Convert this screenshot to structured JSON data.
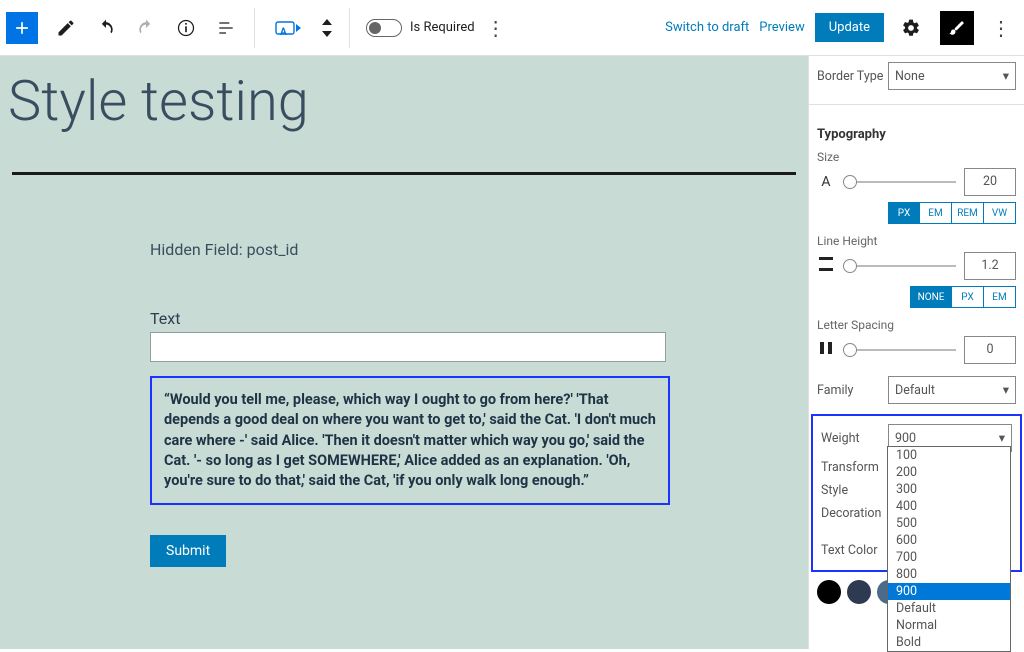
{
  "toolbar": {
    "is_required": "Is Required",
    "switch_draft": "Switch to draft",
    "preview": "Preview",
    "update": "Update"
  },
  "page": {
    "title": "Style testing"
  },
  "form": {
    "hidden_field": "Hidden Field: post_id",
    "text_label": "Text",
    "quote": "“Would you tell me, please, which way I ought to go from here?' 'That depends a good deal on where you want to get to,' said the Cat. 'I don't much care where -' said Alice. 'Then it doesn't matter which way you go,' said the Cat. '- so long as I get SOMEWHERE,' Alice added as an explanation. 'Oh, you're sure to do that,' said the Cat, 'if you only walk long enough.”",
    "submit": "Submit"
  },
  "sidebar": {
    "border_type": {
      "label": "Border Type",
      "value": "None"
    },
    "typography_heading": "Typography",
    "size": {
      "label": "Size",
      "value": "20",
      "units": [
        "PX",
        "EM",
        "REM",
        "VW"
      ],
      "unit_active": "PX"
    },
    "line_height": {
      "label": "Line Height",
      "value": "1.2",
      "units": [
        "NONE",
        "PX",
        "EM"
      ],
      "unit_active": "NONE"
    },
    "letter_spacing": {
      "label": "Letter Spacing",
      "value": "0"
    },
    "family": {
      "label": "Family",
      "value": "Default"
    },
    "weight": {
      "label": "Weight",
      "value": "900",
      "options": [
        "100",
        "200",
        "300",
        "400",
        "500",
        "600",
        "700",
        "800",
        "900",
        "Default",
        "Normal",
        "Bold"
      ],
      "selected": "900"
    },
    "transform": {
      "label": "Transform"
    },
    "style": {
      "label": "Style"
    },
    "decoration": {
      "label": "Decoration"
    },
    "text_color": {
      "label": "Text Color",
      "swatches": [
        "#000000",
        "#2d3a52",
        "#4c6b8a",
        "#9cb0bc",
        "#e0e7ea"
      ]
    }
  }
}
